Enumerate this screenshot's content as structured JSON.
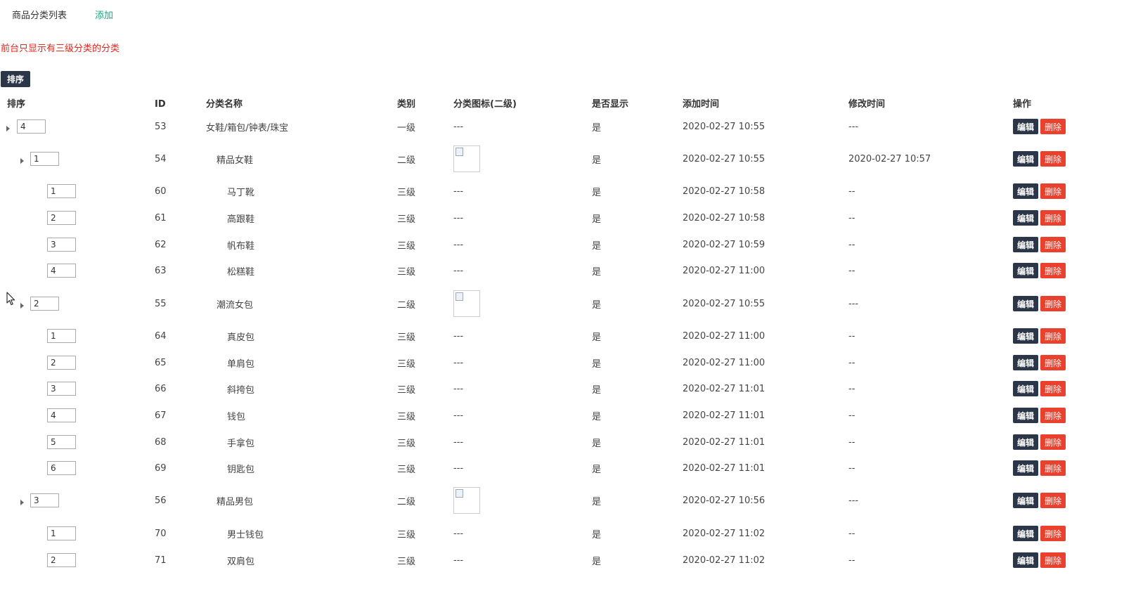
{
  "tabs": {
    "list": "商品分类列表",
    "add": "添加"
  },
  "notice": "前台只显示有三级分类的分类",
  "sort_button": "排序",
  "headers": {
    "sort": "排序",
    "id": "ID",
    "name": "分类名称",
    "level": "类别",
    "icon": "分类图标(二级)",
    "visible": "是否显示",
    "created": "添加时间",
    "modified": "修改时间",
    "actions": "操作"
  },
  "action_labels": {
    "edit": "编辑",
    "delete": "删除"
  },
  "rows": [
    {
      "depth": 1,
      "sort": "4",
      "id": "53",
      "name": "女鞋/箱包/钟表/珠宝",
      "level": "一级",
      "icon": "---",
      "visible": "是",
      "created": "2020-02-27 10:55",
      "modified": "---"
    },
    {
      "depth": 2,
      "sort": "1",
      "id": "54",
      "name": "精品女鞋",
      "level": "二级",
      "icon": "image",
      "visible": "是",
      "created": "2020-02-27 10:55",
      "modified": "2020-02-27 10:57"
    },
    {
      "depth": 3,
      "sort": "1",
      "id": "60",
      "name": "马丁靴",
      "level": "三级",
      "icon": "---",
      "visible": "是",
      "created": "2020-02-27 10:58",
      "modified": "--"
    },
    {
      "depth": 3,
      "sort": "2",
      "id": "61",
      "name": "高跟鞋",
      "level": "三级",
      "icon": "---",
      "visible": "是",
      "created": "2020-02-27 10:58",
      "modified": "--"
    },
    {
      "depth": 3,
      "sort": "3",
      "id": "62",
      "name": "帆布鞋",
      "level": "三级",
      "icon": "---",
      "visible": "是",
      "created": "2020-02-27 10:59",
      "modified": "--"
    },
    {
      "depth": 3,
      "sort": "4",
      "id": "63",
      "name": "松糕鞋",
      "level": "三级",
      "icon": "---",
      "visible": "是",
      "created": "2020-02-27 11:00",
      "modified": "--"
    },
    {
      "depth": 2,
      "sort": "2",
      "id": "55",
      "name": "潮流女包",
      "level": "二级",
      "icon": "image",
      "visible": "是",
      "created": "2020-02-27 10:55",
      "modified": "---"
    },
    {
      "depth": 3,
      "sort": "1",
      "id": "64",
      "name": "真皮包",
      "level": "三级",
      "icon": "---",
      "visible": "是",
      "created": "2020-02-27 11:00",
      "modified": "--"
    },
    {
      "depth": 3,
      "sort": "2",
      "id": "65",
      "name": "单肩包",
      "level": "三级",
      "icon": "---",
      "visible": "是",
      "created": "2020-02-27 11:00",
      "modified": "--"
    },
    {
      "depth": 3,
      "sort": "3",
      "id": "66",
      "name": "斜挎包",
      "level": "三级",
      "icon": "---",
      "visible": "是",
      "created": "2020-02-27 11:01",
      "modified": "--"
    },
    {
      "depth": 3,
      "sort": "4",
      "id": "67",
      "name": "钱包",
      "level": "三级",
      "icon": "---",
      "visible": "是",
      "created": "2020-02-27 11:01",
      "modified": "--"
    },
    {
      "depth": 3,
      "sort": "5",
      "id": "68",
      "name": "手拿包",
      "level": "三级",
      "icon": "---",
      "visible": "是",
      "created": "2020-02-27 11:01",
      "modified": "--"
    },
    {
      "depth": 3,
      "sort": "6",
      "id": "69",
      "name": "钥匙包",
      "level": "三级",
      "icon": "---",
      "visible": "是",
      "created": "2020-02-27 11:01",
      "modified": "--"
    },
    {
      "depth": 2,
      "sort": "3",
      "id": "56",
      "name": "精品男包",
      "level": "二级",
      "icon": "image",
      "visible": "是",
      "created": "2020-02-27 10:56",
      "modified": "---"
    },
    {
      "depth": 3,
      "sort": "1",
      "id": "70",
      "name": "男士钱包",
      "level": "三级",
      "icon": "---",
      "visible": "是",
      "created": "2020-02-27 11:02",
      "modified": "--"
    },
    {
      "depth": 3,
      "sort": "2",
      "id": "71",
      "name": "双肩包",
      "level": "三级",
      "icon": "---",
      "visible": "是",
      "created": "2020-02-27 11:02",
      "modified": "--"
    }
  ],
  "colors": {
    "dark_button": "#2b3649",
    "delete_button": "#e9412e",
    "notice": "#e0281f",
    "add_link": "#19a57f"
  },
  "icons": {
    "expand": "caret-right-icon",
    "image_placeholder": "broken-image-icon",
    "pointer": "mouse-cursor-icon"
  }
}
